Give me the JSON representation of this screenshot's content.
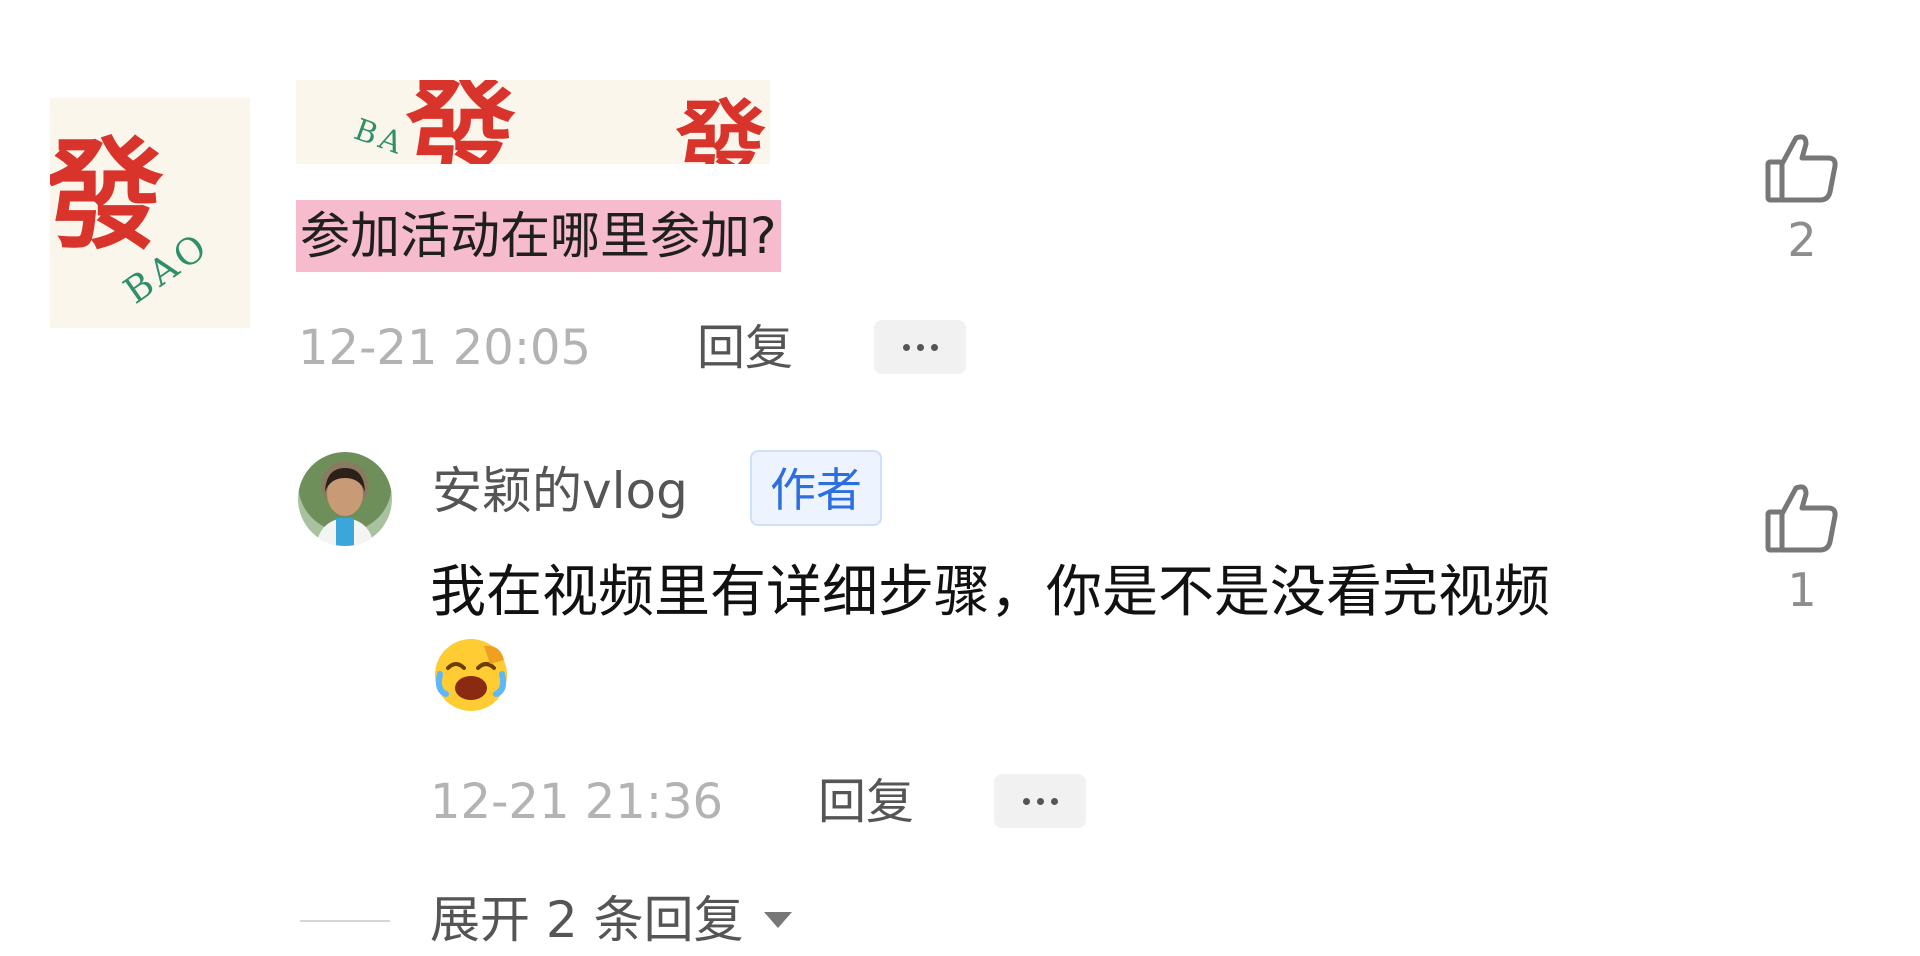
{
  "top_comment": {
    "avatar_text": [
      "發",
      "BAO"
    ],
    "image_text": [
      "BA",
      "發"
    ],
    "text": "参加活动在哪里参加?",
    "time": "12-21 20:05",
    "reply_label": "回复",
    "like_count": "2"
  },
  "reply": {
    "author": "安颖的vlog",
    "badge": "作者",
    "text": "我在视频里有详细步骤，你是不是没看完视频",
    "time": "12-21 21:36",
    "reply_label": "回复",
    "like_count": "1"
  },
  "expand": {
    "label": "展开 2 条回复"
  },
  "icons": {
    "like": "thumbs-up-icon",
    "more": "more-dots-icon",
    "emoji": "laughing-crying-emoji",
    "expand": "chevron-down-icon"
  },
  "colors": {
    "highlight": "#f6bccd",
    "badge_text": "#2e6fe0",
    "badge_bg": "#eef4ff",
    "seal_red": "#d8342b"
  }
}
